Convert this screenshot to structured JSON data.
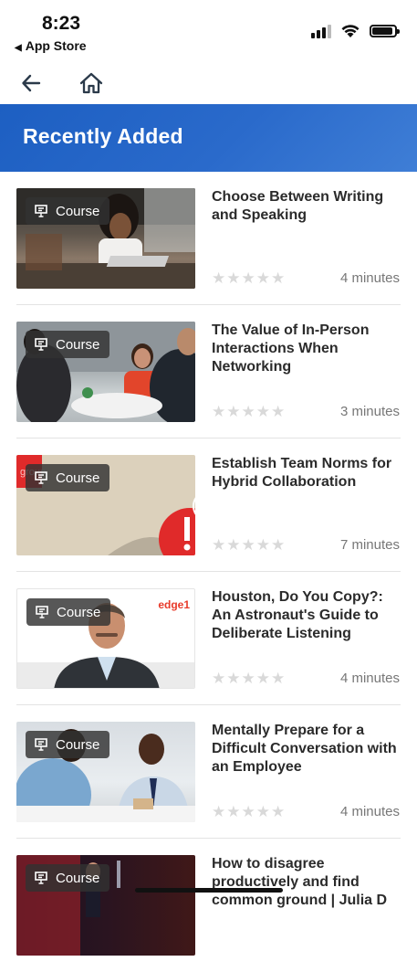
{
  "status": {
    "time": "8:23",
    "back_app": "App Store"
  },
  "header": {
    "title": "Recently Added"
  },
  "courses": [
    {
      "badge": "Course",
      "title": "Choose Between Writing and Speaking",
      "duration": "4 minutes"
    },
    {
      "badge": "Course",
      "title": "The Value of In-Person Interactions When Networking",
      "duration": "3 minutes"
    },
    {
      "badge": "Course",
      "title": "Establish Team Norms for Hybrid Collaboration",
      "duration": "7 minutes",
      "thumb_text": "group"
    },
    {
      "badge": "Course",
      "title": "Houston, Do You Copy?: An Astronaut's Guide to Deliberate Listening",
      "duration": "4 minutes",
      "thumb_text": "edge1"
    },
    {
      "badge": "Course",
      "title": "Mentally Prepare for a Difficult Conversation with an Employee",
      "duration": "4 minutes"
    },
    {
      "badge": "Course",
      "title": "How to disagree productively and find common ground | Julia D",
      "duration": ""
    }
  ],
  "colors": {
    "banner": "#2a6acb",
    "star_empty": "#d9d9d9",
    "text_muted": "#777777"
  },
  "icons": {
    "back": "arrow-left-icon",
    "home": "home-icon",
    "course": "presentation-icon",
    "star": "star-icon"
  }
}
